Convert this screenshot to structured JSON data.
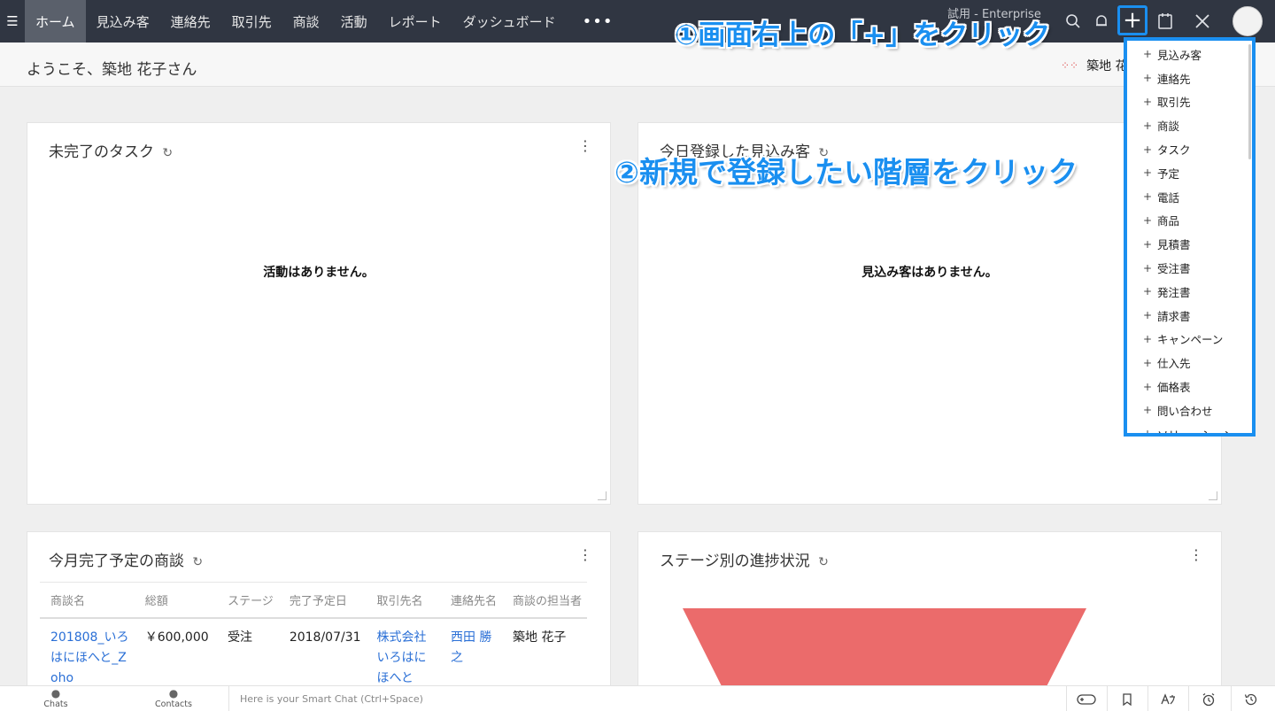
{
  "nav": {
    "items": [
      "ホーム",
      "見込み客",
      "連絡先",
      "取引先",
      "商談",
      "活動",
      "レポート",
      "ダッシュボード"
    ],
    "more": "•••",
    "trial": "試用 - Enterprise",
    "plus": "+"
  },
  "welcome": {
    "text": "ようこそ、築地 花子さん",
    "user": "築地 花子"
  },
  "cards": {
    "tasks": {
      "title": "未完了のタスク",
      "empty": "活動はありません。"
    },
    "leads": {
      "title": "今日登録した見込み客",
      "empty": "見込み客はありません。"
    },
    "deals": {
      "title": "今月完了予定の商談",
      "headers": [
        "商談名",
        "総額",
        "ステージ",
        "完了予定日",
        "取引先名",
        "連絡先名",
        "商談の担当者"
      ],
      "row": {
        "name": "201808_いろはにほへと_Zoho",
        "amount": "￥600,000",
        "stage": "受注",
        "date": "2018/07/31",
        "account": "株式会社いろはにほへと",
        "contact": "西田 勝之",
        "owner": "築地 花子"
      }
    },
    "stage": {
      "title": "ステージ別の進捗状況",
      "funnel_color": "#eb6b6b"
    }
  },
  "dropdown": {
    "items": [
      "見込み客",
      "連絡先",
      "取引先",
      "商談",
      "タスク",
      "予定",
      "電話",
      "商品",
      "見積書",
      "受注書",
      "発注書",
      "請求書",
      "キャンペーン",
      "仕入先",
      "価格表",
      "問い合わせ",
      "ソリューション"
    ]
  },
  "annotations": {
    "step1": "①画面右上の「+」をクリック",
    "step2": "②新規で登録したい階層をクリック"
  },
  "bottom": {
    "chats": "Chats",
    "contacts": "Contacts",
    "smartchat": "Here is your Smart Chat (Ctrl+Space)"
  },
  "colors": {
    "nav_bg": "#303642",
    "accent": "#1a8ff0",
    "link": "#2a6fd6",
    "funnel": "#eb6b6b"
  }
}
